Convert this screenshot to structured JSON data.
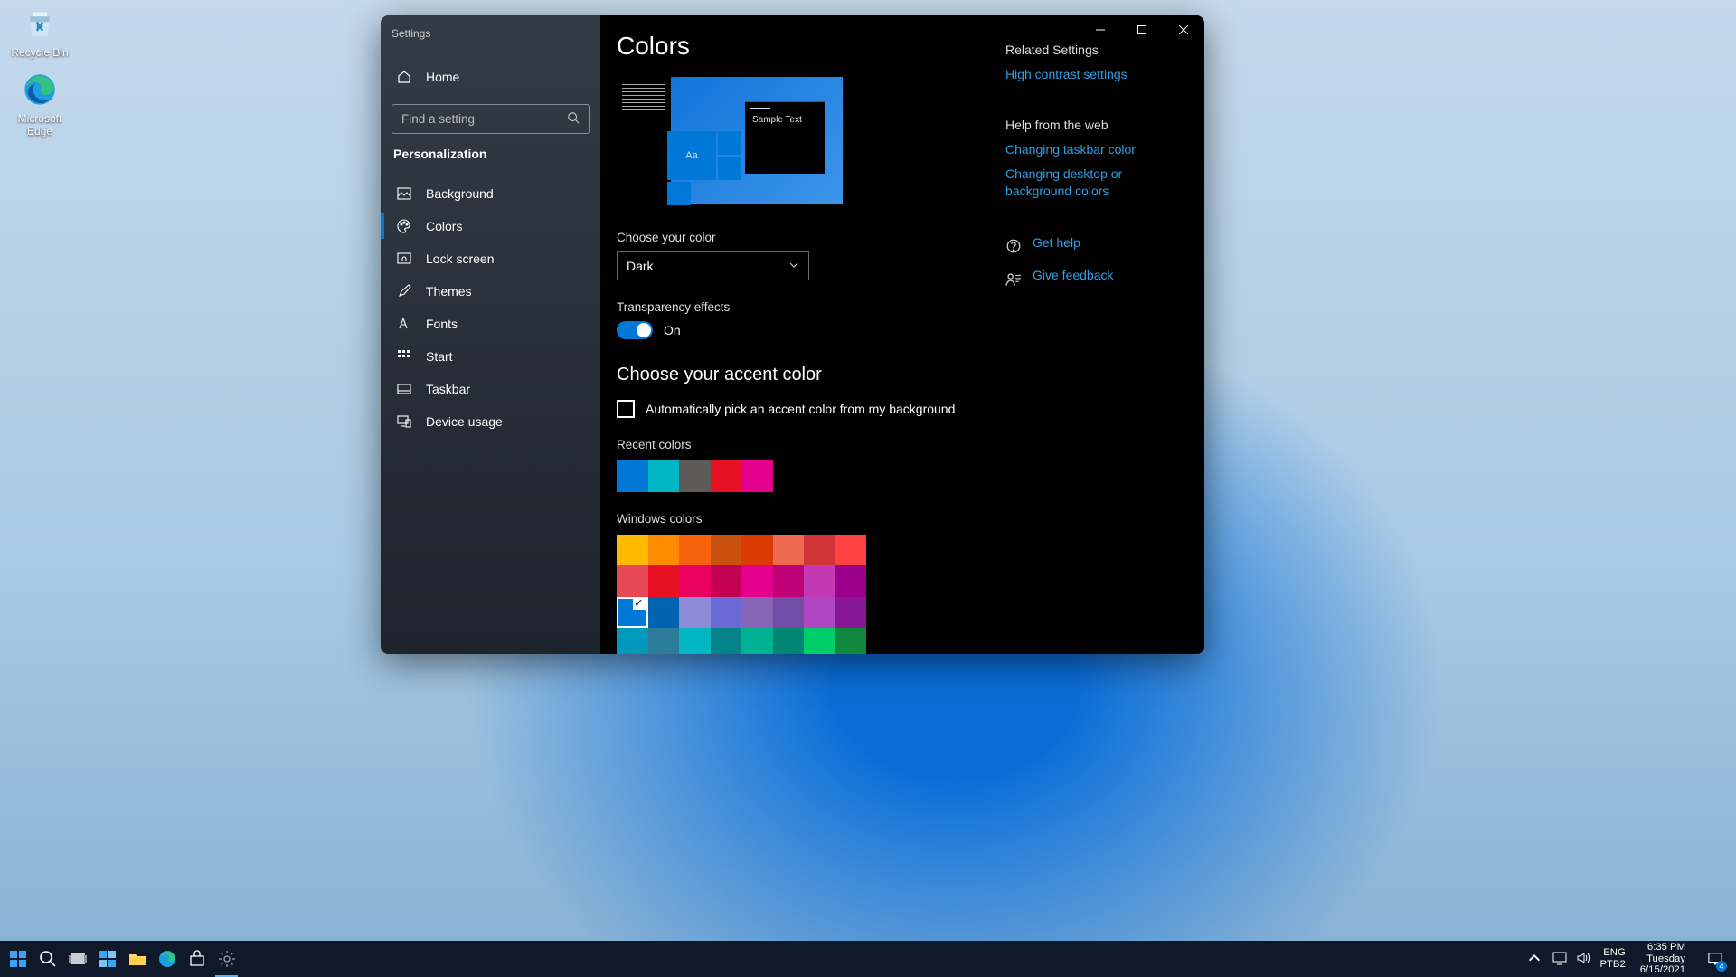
{
  "desktop": {
    "recycle_label": "Recycle Bin",
    "edge_label": "Microsoft Edge"
  },
  "window": {
    "title": "Settings",
    "home": "Home",
    "search_placeholder": "Find a setting",
    "section": "Personalization",
    "nav": {
      "background": "Background",
      "colors": "Colors",
      "lockscreen": "Lock screen",
      "themes": "Themes",
      "fonts": "Fonts",
      "start": "Start",
      "taskbar": "Taskbar",
      "device_usage": "Device usage"
    }
  },
  "page": {
    "title": "Colors",
    "sample_text": "Sample Text",
    "aa": "Aa",
    "choose_color_label": "Choose your color",
    "choose_color_value": "Dark",
    "transparency_label": "Transparency effects",
    "transparency_state": "On",
    "accent_heading": "Choose your accent color",
    "auto_pick": "Automatically pick an accent color from my background",
    "recent_label": "Recent colors",
    "recent_colors": [
      "#0078d7",
      "#00b7c3",
      "#5d5a58",
      "#e81123",
      "#e3008c"
    ],
    "windows_label": "Windows colors",
    "windows_colors": [
      "#ffb900",
      "#ff8c00",
      "#f7630c",
      "#ca5010",
      "#da3b01",
      "#ef6950",
      "#d13438",
      "#ff4343",
      "#e74856",
      "#e81123",
      "#ea005e",
      "#c30052",
      "#e3008c",
      "#bf0077",
      "#c239b3",
      "#9a0089",
      "#0078d7",
      "#0063b1",
      "#8e8cd8",
      "#6b69d6",
      "#8764b8",
      "#744da9",
      "#b146c2",
      "#881798",
      "#0099bc",
      "#2d7d9a",
      "#00b7c3",
      "#038387",
      "#00b294",
      "#018574",
      "#00cc6a",
      "#10893e"
    ],
    "selected_color_index": 16
  },
  "aside": {
    "related_heading": "Related Settings",
    "high_contrast": "High contrast settings",
    "help_heading": "Help from the web",
    "link_taskbar": "Changing taskbar color",
    "link_desktop": "Changing desktop or background colors",
    "get_help": "Get help",
    "give_feedback": "Give feedback"
  },
  "taskbar": {
    "lang1": "ENG",
    "lang2": "PTB2",
    "time": "6:35 PM",
    "day": "Tuesday",
    "date": "6/15/2021",
    "notif_count": "4"
  }
}
